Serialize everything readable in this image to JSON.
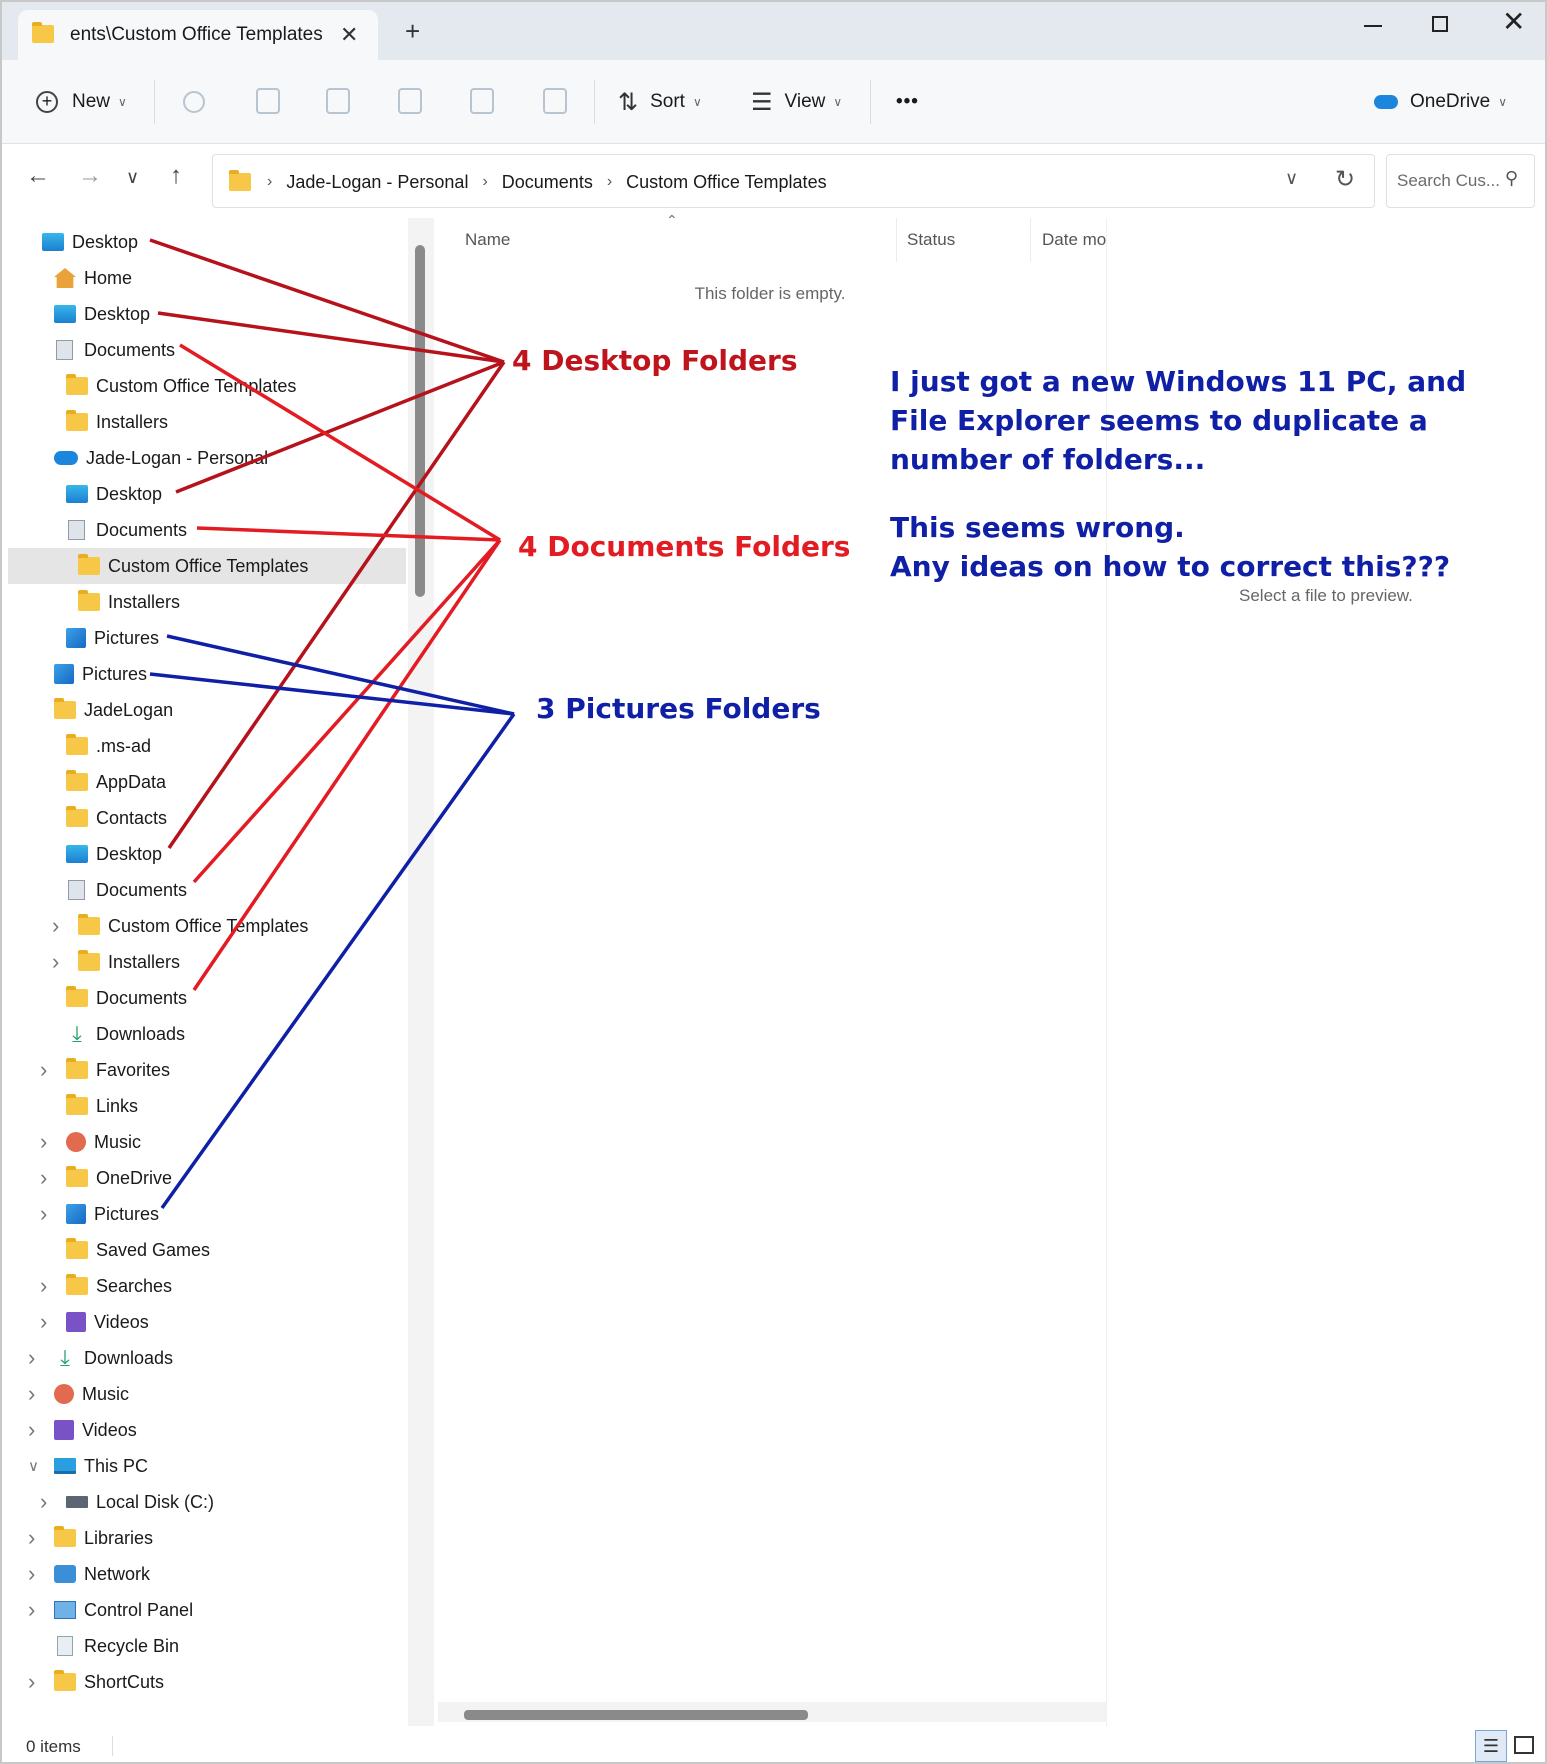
{
  "tab": {
    "title": "ents\\Custom Office Templates",
    "close": "✕",
    "new_tab": "+"
  },
  "window": {
    "minimize": "",
    "maximize": "",
    "close": "✕"
  },
  "toolbar": {
    "new_label": "New",
    "sort_label": "Sort",
    "view_label": "View",
    "more_label": "•••",
    "onedrive_label": "OneDrive"
  },
  "address": {
    "crumbs": [
      "Jade-Logan - Personal",
      "Documents",
      "Custom Office Templates"
    ]
  },
  "search": {
    "placeholder": "Search Cus..."
  },
  "nav_tree": [
    {
      "label": "Desktop",
      "icon": "desktop",
      "indent": 0
    },
    {
      "label": "Home",
      "icon": "home",
      "indent": 1
    },
    {
      "label": "Desktop",
      "icon": "desktop",
      "indent": 1
    },
    {
      "label": "Documents",
      "icon": "documents",
      "indent": 1
    },
    {
      "label": "Custom Office Templates",
      "icon": "folder",
      "indent": 2
    },
    {
      "label": "Installers",
      "icon": "folder",
      "indent": 2
    },
    {
      "label": "Jade-Logan - Personal",
      "icon": "cloud",
      "indent": 1
    },
    {
      "label": "Desktop",
      "icon": "desktop",
      "indent": 2
    },
    {
      "label": "Documents",
      "icon": "documents",
      "indent": 2
    },
    {
      "label": "Custom Office Templates",
      "icon": "folder",
      "indent": 3,
      "selected": true
    },
    {
      "label": "Installers",
      "icon": "folder",
      "indent": 3
    },
    {
      "label": "Pictures",
      "icon": "pictures",
      "indent": 2
    },
    {
      "label": "Pictures",
      "icon": "pictures",
      "indent": 1
    },
    {
      "label": "JadeLogan",
      "icon": "folder",
      "indent": 1
    },
    {
      "label": ".ms-ad",
      "icon": "folder",
      "indent": 2
    },
    {
      "label": "AppData",
      "icon": "folder",
      "indent": 2
    },
    {
      "label": "Contacts",
      "icon": "folder",
      "indent": 2
    },
    {
      "label": "Desktop",
      "icon": "desktop",
      "indent": 2
    },
    {
      "label": "Documents",
      "icon": "documents",
      "indent": 2
    },
    {
      "label": "Custom Office Templates",
      "icon": "folder",
      "indent": 3,
      "expandable": true
    },
    {
      "label": "Installers",
      "icon": "folder",
      "indent": 3,
      "expandable": true
    },
    {
      "label": "Documents",
      "icon": "folder",
      "indent": 2
    },
    {
      "label": "Downloads",
      "icon": "downloads",
      "indent": 2
    },
    {
      "label": "Favorites",
      "icon": "folder",
      "indent": 2,
      "expandable": true
    },
    {
      "label": "Links",
      "icon": "folder",
      "indent": 2
    },
    {
      "label": "Music",
      "icon": "music",
      "indent": 2,
      "expandable": true
    },
    {
      "label": "OneDrive",
      "icon": "folder",
      "indent": 2,
      "expandable": true
    },
    {
      "label": "Pictures",
      "icon": "pictures",
      "indent": 2,
      "expandable": true
    },
    {
      "label": "Saved Games",
      "icon": "folder",
      "indent": 2
    },
    {
      "label": "Searches",
      "icon": "folder",
      "indent": 2,
      "expandable": true
    },
    {
      "label": "Videos",
      "icon": "videos",
      "indent": 2,
      "expandable": true
    },
    {
      "label": "Downloads",
      "icon": "downloads",
      "indent": 1,
      "expandable": true
    },
    {
      "label": "Music",
      "icon": "music",
      "indent": 1,
      "expandable": true
    },
    {
      "label": "Videos",
      "icon": "videos",
      "indent": 1,
      "expandable": true
    },
    {
      "label": "This PC",
      "icon": "thispc",
      "indent": 1,
      "expanded": true
    },
    {
      "label": "Local Disk (C:)",
      "icon": "disk",
      "indent": 2,
      "expandable": true
    },
    {
      "label": "Libraries",
      "icon": "folder",
      "indent": 1,
      "expandable": true
    },
    {
      "label": "Network",
      "icon": "network",
      "indent": 1,
      "expandable": true
    },
    {
      "label": "Control Panel",
      "icon": "cpanel",
      "indent": 1,
      "expandable": true
    },
    {
      "label": "Recycle Bin",
      "icon": "recycle",
      "indent": 1
    },
    {
      "label": "ShortCuts",
      "icon": "folder",
      "indent": 1,
      "expandable": true
    }
  ],
  "file_list": {
    "columns": [
      "Name",
      "Status",
      "Date mo"
    ],
    "empty_message": "This folder is empty."
  },
  "preview": {
    "message": "Select a file to preview."
  },
  "status": {
    "items": "0 items"
  },
  "annotations": {
    "desktop_label": "4 Desktop Folders",
    "documents_label": "4 Documents Folders",
    "pictures_label": "3 Pictures Folders",
    "question_lines": [
      "I just got a new Windows 11 PC, and",
      "File Explorer seems to duplicate a",
      "number of folders...",
      "",
      "This seems wrong.",
      "Any ideas on how to correct this???"
    ],
    "colors": {
      "desktop": "#c0141c",
      "documents": "#e31b23",
      "pictures": "#0f1fa6"
    }
  }
}
